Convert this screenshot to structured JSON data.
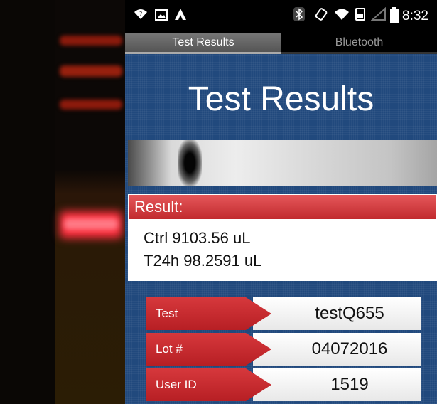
{
  "status_bar": {
    "time": "8:32",
    "left_icons": [
      "wifi-question-icon",
      "image-icon",
      "app-a-icon"
    ],
    "right_icons": [
      "bluetooth-icon",
      "rotate-icon",
      "wifi-icon",
      "battery-saver-icon",
      "signal-icon",
      "battery-icon"
    ]
  },
  "tabs": [
    {
      "label": "Test Results",
      "active": true
    },
    {
      "label": "Bluetooth",
      "active": false
    }
  ],
  "page": {
    "title": "Test Results"
  },
  "result": {
    "header": "Result:",
    "lines": [
      "Ctrl 9103.56 uL",
      "T24h 98.2591 uL"
    ]
  },
  "info_table": [
    {
      "label": "Test",
      "value": "testQ655"
    },
    {
      "label": "Lot #",
      "value": "04072016"
    },
    {
      "label": "User ID",
      "value": "1519"
    }
  ],
  "colors": {
    "background_blue": "#21497d",
    "accent_red": "#c12a2e"
  }
}
